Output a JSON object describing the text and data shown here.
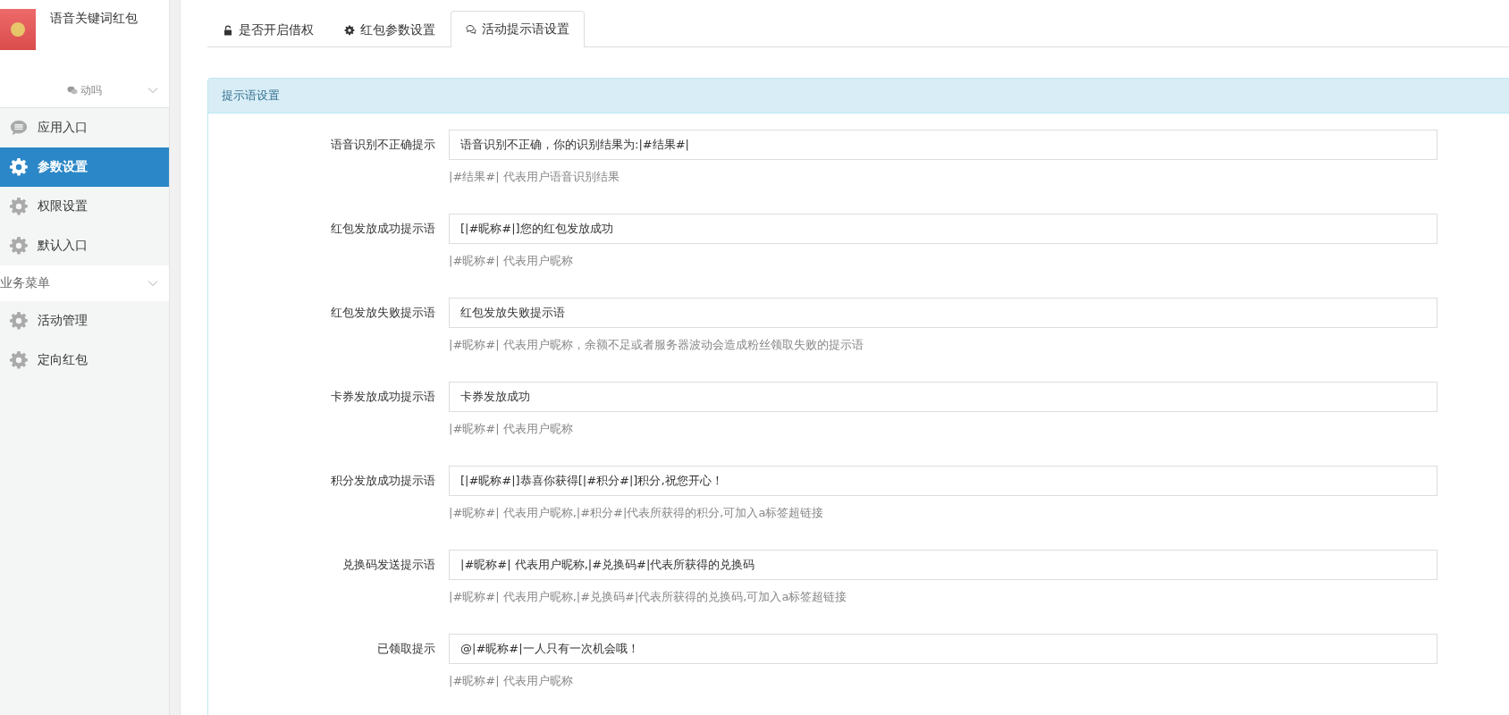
{
  "app": {
    "title": "语音关键词红包",
    "account": "动吗"
  },
  "sidebar": {
    "groups": [
      {
        "expanded": true,
        "items": [
          {
            "label": "应用入口",
            "kind": "chat",
            "selected": false
          },
          {
            "label": "参数设置",
            "kind": "gear",
            "selected": true
          },
          {
            "label": "权限设置",
            "kind": "gear",
            "selected": false
          },
          {
            "label": "默认入口",
            "kind": "gear",
            "selected": false
          }
        ]
      },
      {
        "title": "业务菜单",
        "expanded": true,
        "items": [
          {
            "label": "活动管理",
            "kind": "gear",
            "selected": false
          },
          {
            "label": "定向红包",
            "kind": "gear",
            "selected": false
          }
        ]
      }
    ]
  },
  "tabs": [
    {
      "label": "是否开启借权",
      "kind": "lock",
      "selected": false
    },
    {
      "label": "红包参数设置",
      "kind": "gear",
      "selected": false
    },
    {
      "label": "活动提示语设置",
      "kind": "chat",
      "selected": true
    }
  ],
  "panel": {
    "title": "提示语设置",
    "fields": [
      {
        "label": "语音识别不正确提示",
        "value": "语音识别不正确，你的识别结果为:|#结果#|",
        "help": "|#结果#| 代表用户语音识别结果"
      },
      {
        "label": "红包发放成功提示语",
        "value": "[|#昵称#|]您的红包发放成功",
        "help": "|#昵称#| 代表用户昵称"
      },
      {
        "label": "红包发放失败提示语",
        "value": "红包发放失败提示语",
        "help": "|#昵称#| 代表用户昵称，余额不足或者服务器波动会造成粉丝领取失败的提示语"
      },
      {
        "label": "卡券发放成功提示语",
        "value": "卡券发放成功",
        "help": "|#昵称#| 代表用户昵称"
      },
      {
        "label": "积分发放成功提示语",
        "value": "[|#昵称#|]恭喜你获得[|#积分#|]积分,祝您开心！",
        "help": "|#昵称#| 代表用户昵称,|#积分#|代表所获得的积分,可加入a标签超链接"
      },
      {
        "label": "兑换码发送提示语",
        "value": "|#昵称#| 代表用户昵称,|#兑换码#|代表所获得的兑换码",
        "help": "|#昵称#| 代表用户昵称,|#兑换码#|代表所获得的兑换码,可加入a标签超链接"
      },
      {
        "label": "已领取提示",
        "value": "@|#昵称#|一人只有一次机会哦！",
        "help": "|#昵称#| 代表用户昵称"
      }
    ]
  }
}
